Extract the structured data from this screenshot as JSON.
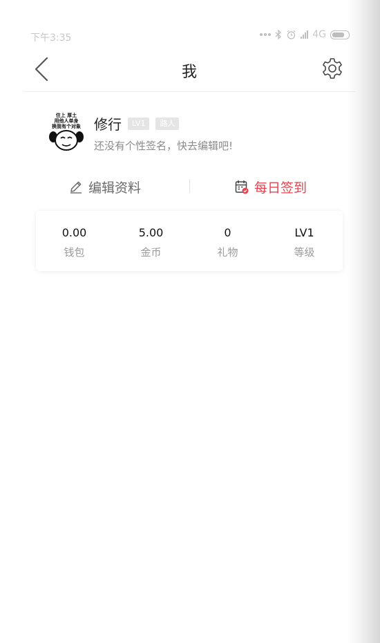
{
  "status_bar": {
    "time": "下午3:35",
    "network": "4G"
  },
  "nav": {
    "title": "我"
  },
  "profile": {
    "name": "修行",
    "level_badge": "LV1",
    "role_badge": "路人",
    "signature": "还没有个性签名，快去编辑吧!",
    "avatar_lines": [
      "住上 厚土",
      "用他人单身",
      "换我有个对象"
    ]
  },
  "actions": {
    "edit_label": "编辑资料",
    "checkin_label": "每日签到"
  },
  "stats": [
    {
      "value": "0.00",
      "label": "钱包"
    },
    {
      "value": "5.00",
      "label": "金币"
    },
    {
      "value": "0",
      "label": "礼物"
    },
    {
      "value": "LV1",
      "label": "等级"
    }
  ],
  "colors": {
    "accent": "#e8434e",
    "muted": "#8a8a8a"
  }
}
